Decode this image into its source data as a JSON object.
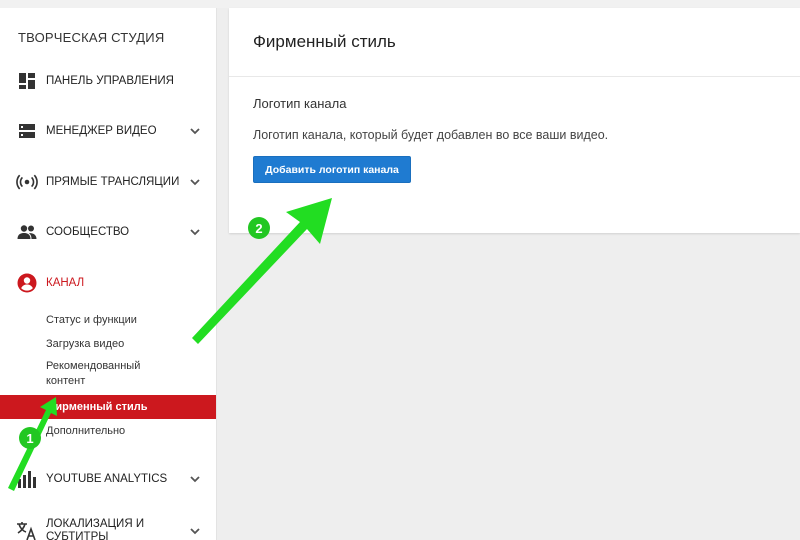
{
  "sidebar": {
    "studio_title": "ТВОРЧЕСКАЯ СТУДИЯ",
    "items": [
      {
        "label": "ПАНЕЛЬ УПРАВЛЕНИЯ",
        "icon": "dashboard-icon",
        "has_chevron": false
      },
      {
        "label": "МЕНЕДЖЕР ВИДЕО",
        "icon": "video-manager-icon",
        "has_chevron": true
      },
      {
        "label": "ПРЯМЫЕ ТРАНСЛЯЦИИ",
        "icon": "live-stream-icon",
        "has_chevron": true
      },
      {
        "label": "СООБЩЕСТВО",
        "icon": "community-icon",
        "has_chevron": true
      },
      {
        "label": "КАНАЛ",
        "icon": "channel-icon",
        "has_chevron": false,
        "active": true
      },
      {
        "label": "YOUTUBE ANALYTICS",
        "icon": "analytics-icon",
        "has_chevron": true
      },
      {
        "label": "ЛОКАЛИЗАЦИЯ И СУБТИТРЫ",
        "icon": "translate-icon",
        "has_chevron": true
      }
    ],
    "channel_subitems": [
      "Статус и функции",
      "Загрузка видео",
      "Рекомендованный контент",
      "Фирменный стиль",
      "Дополнительно"
    ],
    "selected_subitem": "Фирменный стиль"
  },
  "main": {
    "title": "Фирменный стиль",
    "section_title": "Логотип канала",
    "section_description": "Логотип канала, который будет добавлен во все ваши видео.",
    "add_logo_button": "Добавить логотип канала"
  },
  "annotations": {
    "badge_1": "1",
    "badge_2": "2"
  },
  "colors": {
    "accent_red": "#cc181e",
    "button_blue": "#1f7bd1",
    "annotation_green": "#22dd22",
    "background": "#eeeeee"
  }
}
